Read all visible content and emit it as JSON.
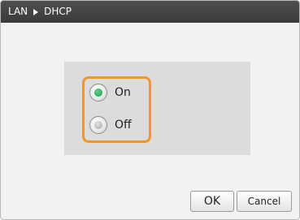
{
  "titlebar": {
    "breadcrumb": [
      "LAN",
      "DHCP"
    ]
  },
  "dhcp_options": [
    {
      "label": "On",
      "selected": true
    },
    {
      "label": "Off",
      "selected": false
    }
  ],
  "buttons": {
    "ok_label": "OK",
    "cancel_label": "Cancel"
  },
  "colors": {
    "titlebar_bg": "#3f3f3f",
    "highlight_border": "#f0962e",
    "selected_radio": "#1f9a4c"
  }
}
